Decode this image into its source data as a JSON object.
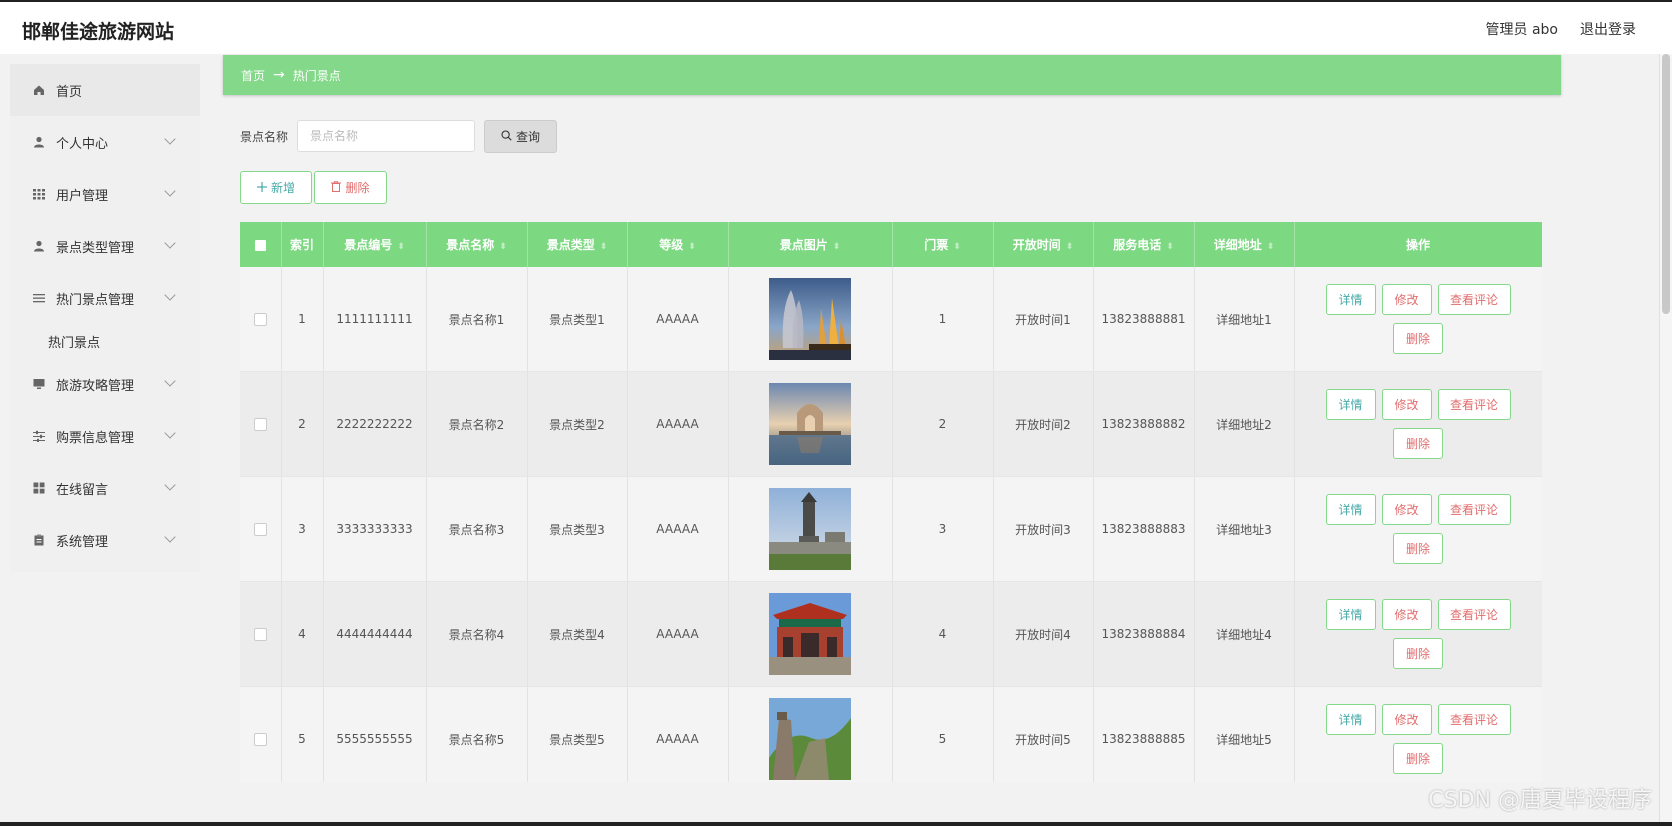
{
  "header": {
    "site_title": "邯郸佳途旅游网站",
    "admin_label": "管理员 abo",
    "logout_label": "退出登录"
  },
  "sidebar": {
    "items": [
      {
        "label": "首页",
        "icon": "home-icon"
      },
      {
        "label": "个人中心",
        "icon": "user-icon"
      },
      {
        "label": "用户管理",
        "icon": "grid-icon"
      },
      {
        "label": "景点类型管理",
        "icon": "user-icon"
      },
      {
        "label": "热门景点管理",
        "icon": "list-icon"
      },
      {
        "label": "旅游攻略管理",
        "icon": "monitor-icon"
      },
      {
        "label": "购票信息管理",
        "icon": "sliders-icon"
      },
      {
        "label": "在线留言",
        "icon": "apps-icon"
      },
      {
        "label": "系统管理",
        "icon": "clipboard-icon"
      }
    ],
    "subitem": "热门景点"
  },
  "breadcrumb": {
    "home": "首页",
    "arrow": "→",
    "current": "热门景点"
  },
  "search": {
    "label": "景点名称",
    "placeholder": "景点名称",
    "button": "查询"
  },
  "actions": {
    "add": "新增",
    "delete": "删除"
  },
  "table": {
    "columns": [
      "索引",
      "景点编号",
      "景点名称",
      "景点类型",
      "等级",
      "景点图片",
      "门票",
      "开放时间",
      "服务电话",
      "详细地址",
      "操作"
    ],
    "rows": [
      {
        "index": "1",
        "code": "1111111111",
        "name": "景点名称1",
        "type": "景点类型1",
        "level": "AAAAA",
        "ticket": "1",
        "open_time": "开放时间1",
        "phone": "13823888881",
        "address": "详细地址1"
      },
      {
        "index": "2",
        "code": "2222222222",
        "name": "景点名称2",
        "type": "景点类型2",
        "level": "AAAAA",
        "ticket": "2",
        "open_time": "开放时间2",
        "phone": "13823888882",
        "address": "详细地址2"
      },
      {
        "index": "3",
        "code": "3333333333",
        "name": "景点名称3",
        "type": "景点类型3",
        "level": "AAAAA",
        "ticket": "3",
        "open_time": "开放时间3",
        "phone": "13823888883",
        "address": "详细地址3"
      },
      {
        "index": "4",
        "code": "4444444444",
        "name": "景点名称4",
        "type": "景点类型4",
        "level": "AAAAA",
        "ticket": "4",
        "open_time": "开放时间4",
        "phone": "13823888884",
        "address": "详细地址4"
      },
      {
        "index": "5",
        "code": "5555555555",
        "name": "景点名称5",
        "type": "景点类型5",
        "level": "AAAAA",
        "ticket": "5",
        "open_time": "开放时间5",
        "phone": "13823888885",
        "address": "详细地址5"
      }
    ],
    "row_ops": {
      "detail": "详情",
      "edit": "修改",
      "review": "查看评论",
      "delete": "删除"
    }
  },
  "watermark": "CSDN @唐夏毕设程序",
  "colors": {
    "accent_green": "#84d889",
    "header_green": "#7dd882",
    "detail_text": "#46a9a8",
    "danger_text": "#e26d6d"
  }
}
